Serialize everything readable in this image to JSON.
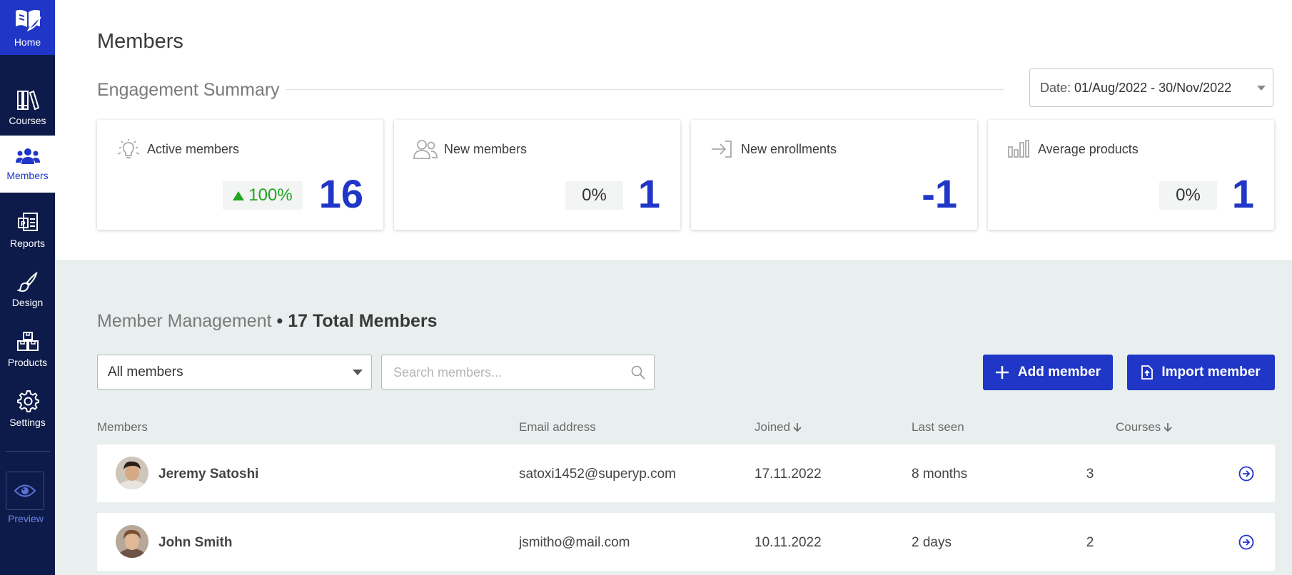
{
  "sidebar": {
    "home_label": "Home",
    "items": [
      {
        "label": "Courses",
        "icon": "books-icon"
      },
      {
        "label": "Members",
        "icon": "users-icon"
      },
      {
        "label": "Reports",
        "icon": "report-icon"
      },
      {
        "label": "Design",
        "icon": "brush-icon"
      },
      {
        "label": "Products",
        "icon": "boxes-icon"
      },
      {
        "label": "Settings",
        "icon": "gear-icon"
      }
    ],
    "preview_label": "Preview",
    "active": "Members"
  },
  "page": {
    "title": "Members"
  },
  "engagement": {
    "title": "Engagement Summary",
    "date_prefix": "Date:",
    "date_value": "01/Aug/2022 - 30/Nov/2022",
    "cards": [
      {
        "title": "Active members",
        "badge": "100%",
        "trend": "up",
        "value": "16",
        "icon": "lightbulb-icon"
      },
      {
        "title": "New members",
        "badge": "0%",
        "value": "1",
        "icon": "users-outline-icon"
      },
      {
        "title": "New enrollments",
        "value": "-1",
        "icon": "enter-arrow-icon"
      },
      {
        "title": "Average products",
        "badge": "0%",
        "value": "1",
        "icon": "bar-chart-icon"
      }
    ]
  },
  "management": {
    "title": "Member Management",
    "total": "• 17 Total Members",
    "filter_value": "All members",
    "search_placeholder": "Search members...",
    "add_label": "Add member",
    "import_label": "Import member"
  },
  "table": {
    "headers": {
      "members": "Members",
      "email": "Email address",
      "joined": "Joined",
      "last_seen": "Last seen",
      "courses": "Courses"
    },
    "rows": [
      {
        "name": "Jeremy Satoshi",
        "email": "satoxi1452@superyp.com",
        "joined": "17.11.2022",
        "last_seen": "8 months",
        "courses": "3"
      },
      {
        "name": "John Smith",
        "email": "jsmitho@mail.com",
        "joined": "10.11.2022",
        "last_seen": "2 days",
        "courses": "2"
      }
    ]
  },
  "colors": {
    "accent": "#1f36c7",
    "sidebar_bg": "#0d1b4a",
    "trend_up": "#22a522",
    "section_bg": "#e9efef"
  }
}
